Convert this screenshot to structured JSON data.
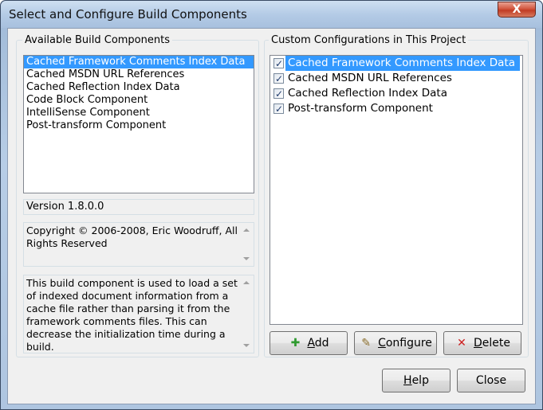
{
  "window": {
    "title": "Select and Configure Build Components",
    "close_label": "X"
  },
  "available": {
    "label": "Available Build Components",
    "items": [
      "Cached Framework Comments Index Data",
      "Cached MSDN URL References",
      "Cached Reflection Index Data",
      "Code Block Component",
      "IntelliSense Component",
      "Post-transform Component"
    ],
    "selected_index": 0
  },
  "version": "Version 1.8.0.0",
  "copyright": "Copyright © 2006-2008, Eric Woodruff, All Rights Reserved",
  "description": "This build component is used to load a set of indexed document information from a cache file rather than parsing it from the framework comments files.  This can decrease the initialization time during a build.",
  "custom": {
    "label": "Custom Configurations in This Project",
    "items": [
      {
        "label": "Cached Framework Comments Index Data",
        "checked": true
      },
      {
        "label": "Cached MSDN URL References",
        "checked": true
      },
      {
        "label": "Cached Reflection Index Data",
        "checked": true
      },
      {
        "label": "Post-transform Component",
        "checked": true
      }
    ]
  },
  "buttons": {
    "add": "Add",
    "configure": "Configure",
    "delete": "Delete",
    "help": "Help",
    "close": "Close"
  },
  "icons": {
    "add": "add-plus-icon",
    "configure": "configure-wand-icon",
    "delete": "delete-x-icon"
  },
  "colors": {
    "selection": "#3399ff",
    "delete_icon": "#cc1f1f",
    "add_icon": "#2f9a2f"
  }
}
